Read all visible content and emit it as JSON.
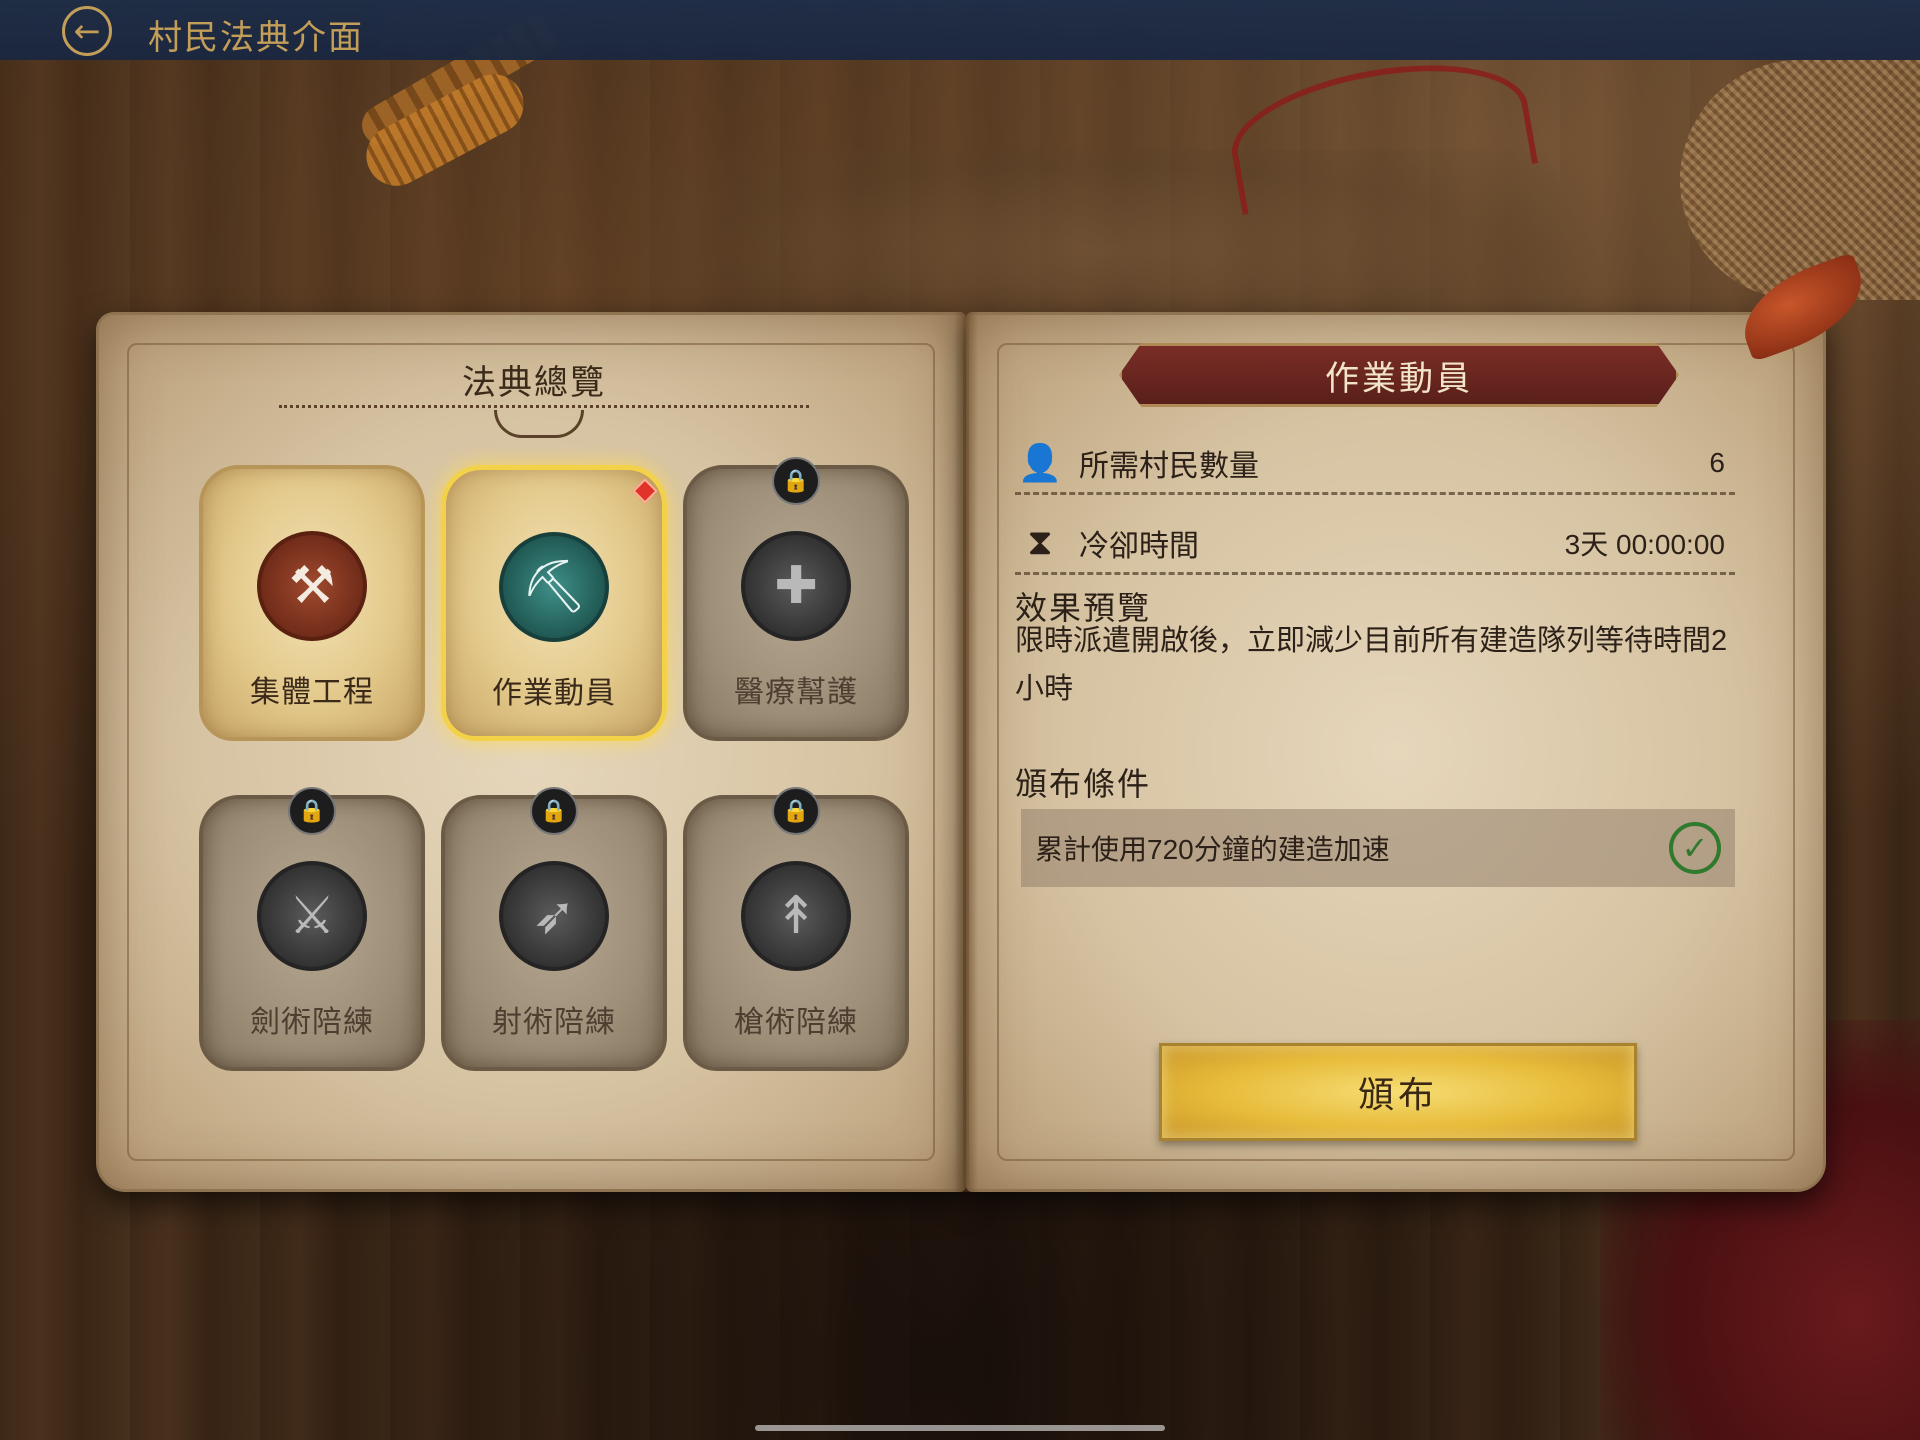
{
  "header": {
    "back_icon": "arrow-left-icon",
    "title": "村民法典介面"
  },
  "left_page": {
    "title": "法典總覽",
    "cards": [
      {
        "label": "集體工程",
        "icon": "hammer-icon",
        "state": "unlocked",
        "accent": "#8a3a22"
      },
      {
        "label": "作業動員",
        "icon": "pickaxe-icon",
        "state": "selected",
        "accent": "#2f7a74",
        "notification": true
      },
      {
        "label": "醫療幫護",
        "icon": "medic-icon",
        "state": "locked"
      },
      {
        "label": "劍術陪練",
        "icon": "sword-icon",
        "state": "locked"
      },
      {
        "label": "射術陪練",
        "icon": "bow-icon",
        "state": "locked"
      },
      {
        "label": "槍術陪練",
        "icon": "spear-icon",
        "state": "locked"
      }
    ]
  },
  "right_page": {
    "banner_title": "作業動員",
    "stats": [
      {
        "icon": "villager-icon",
        "label": "所需村民數量",
        "value": "6"
      },
      {
        "icon": "hourglass-icon",
        "label": "冷卻時間",
        "value": "3天 00:00:00"
      }
    ],
    "effect_heading": "效果預覽",
    "effect_text": "限時派遣開啟後，立即減少目前所有建造隊列等待時間2小時",
    "condition_heading": "頒布條件",
    "conditions": [
      {
        "text": "累計使用720分鐘的建造加速",
        "met": true,
        "icon": "check-circle-icon"
      }
    ],
    "issue_button": "頒布"
  },
  "colors": {
    "gold_accent": "#c9a45c",
    "banner": "#5a1f1a",
    "button_gold": "#e7bb3a",
    "check_green": "#2f7a2d",
    "notify_red": "#e0342a"
  }
}
